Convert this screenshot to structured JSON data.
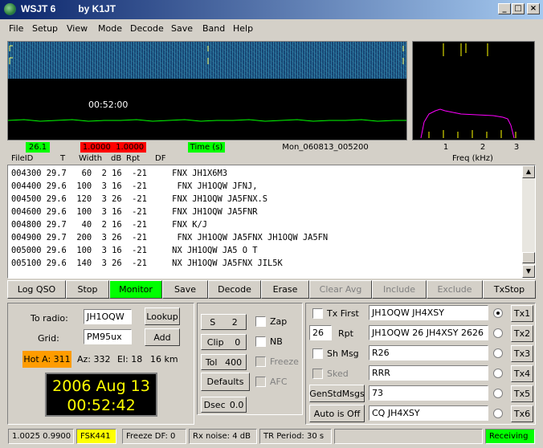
{
  "window": {
    "title": "WSJT 6",
    "subtitle": "by K1JT"
  },
  "menu": [
    "File",
    "Setup",
    "View",
    "Mode",
    "Decode",
    "Save",
    "Band",
    "Help"
  ],
  "waterfall": {
    "time_label": "00:52:00"
  },
  "status_row": {
    "val1": "26.1",
    "val2": "1.0000",
    "val3": "1.0000",
    "time_mode": "Time (s)",
    "file_id": "Mon_060813_005200",
    "freq_ticks": [
      "1",
      "2",
      "3"
    ],
    "freq_unit": "Freq (kHz)"
  },
  "columns": [
    "FileID",
    "T",
    "Width",
    "dB",
    "Rpt",
    "DF"
  ],
  "decodes": [
    "004300 29.7   60  2 16  -21     FNX JH1X6M3",
    "004400 29.6  100  3 16  -21      FNX JH1OQW JFNJ,",
    "004500 29.6  120  3 26  -21     FNX JH1OQW JA5FNX.S",
    "004600 29.6  100  3 16  -21     FNX JH1OQW JA5FNR",
    "004800 29.7   40  2 16  -21     FNX K/J",
    "004900 29.7  200  3 26  -21      FNX JH1OQW JA5FNX JH1OQW JA5FN",
    "005000 29.6  100  3 16  -21     NX JH1OQW JA5 O T",
    "005100 29.6  140  3 26  -21     NX JH1OQW JA5FNX JIL5K"
  ],
  "toolbar": [
    "Log QSO",
    "Stop",
    "Monitor",
    "Save",
    "Decode",
    "Erase",
    "Clear Avg",
    "Include",
    "Exclude",
    "TxStop"
  ],
  "station": {
    "to_radio_label": "To radio:",
    "to_radio": "JH1OQW",
    "grid_label": "Grid:",
    "grid": "PM95ux",
    "lookup": "Lookup",
    "add": "Add",
    "hot": "Hot A: 311",
    "az": "Az: 332",
    "el": "El: 18",
    "dist": "16 km",
    "date": "2006 Aug 13",
    "time": "00:52:42"
  },
  "controls": {
    "s_label": "S",
    "s_val": "2",
    "clip_label": "Clip",
    "clip_val": "0",
    "tol_label": "Tol",
    "tol_val": "400",
    "defaults": "Defaults",
    "dsec_label": "Dsec",
    "dsec_val": "0.0",
    "zap": "Zap",
    "nb": "NB",
    "freeze": "Freeze",
    "afc": "AFC"
  },
  "tx": {
    "tx_first": "Tx First",
    "rpt_val": "26",
    "rpt": "Rpt",
    "sh_msg": "Sh Msg",
    "sked": "Sked",
    "gen_std": "GenStdMsgs",
    "auto": "Auto is Off",
    "messages": [
      "JH1OQW JH4XSY",
      "JH1OQW 26 JH4XSY 2626",
      "R26",
      "RRR",
      "73",
      "CQ JH4XSY"
    ],
    "tx_buttons": [
      "Tx1",
      "Tx2",
      "Tx3",
      "Tx4",
      "Tx5",
      "Tx6"
    ]
  },
  "statusbar": {
    "freq": "1.0025 0.9900",
    "mode": "FSK441",
    "freeze_df": "Freeze DF:  0",
    "rx_noise": "Rx noise:  4 dB",
    "tr_period": "TR Period: 30 s",
    "state": "Receiving"
  },
  "colors": {
    "accent_green": "#00ff00",
    "alert_red": "#ff0000",
    "hot_orange": "#ff9c00",
    "mode_yellow": "#ffff00",
    "clock_text": "#ffff00"
  }
}
